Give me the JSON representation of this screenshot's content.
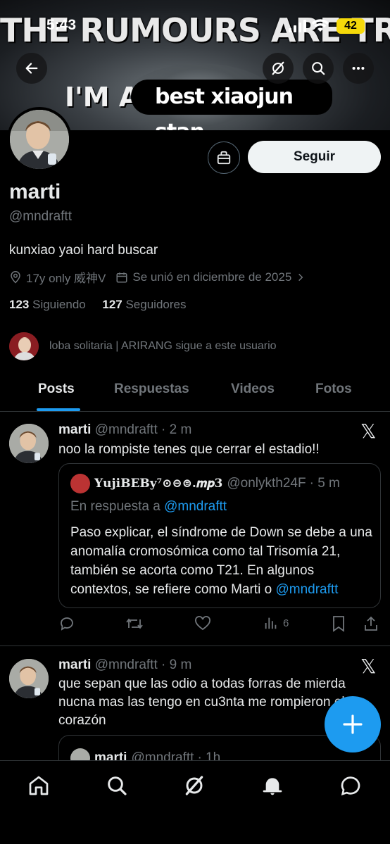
{
  "status": {
    "time": "5:43",
    "battery": "42"
  },
  "banner": {
    "line1": "THE RUMOURS ARE TRUE",
    "line2": "I'M A",
    "highlight": "best xiaojun stan"
  },
  "profile": {
    "name": "marti",
    "handle": "@mndraftt",
    "bio": "kunxiao yaoi hard buscar",
    "location": "17y only 威神V",
    "joined": "Se unió en diciembre de 2025",
    "following_count": "123",
    "following_label": "Siguiendo",
    "followers_count": "127",
    "followers_label": "Seguidores",
    "followed_by": "loba solitaria | ARIRANG sigue a este usuario",
    "follow_button": "Seguir"
  },
  "tabs": [
    "Posts",
    "Respuestas",
    "Videos",
    "Fotos"
  ],
  "posts": [
    {
      "name": "marti",
      "handle": "@mndraftt",
      "time": "· 2 m",
      "text": "noo la rompiste tenes que cerrar el estadio!!",
      "quote": {
        "name": "𝐘𝐮𝐣𝐢𝐁𝐄𝐁𝐲⁷⊙⊝⊜.𝒎𝒑𝟑",
        "handle": "@onlykth24F",
        "time": "· 5 m",
        "reply_prefix": "En respuesta a",
        "reply_handle": "@mndraftt",
        "text": "Paso explicar, el síndrome de Down se debe a una anomalía cromosómica como tal Trisomía 21, también se acorta como T21. En algunos contextos, se refiere como Marti o",
        "mention": "@mndraftt"
      },
      "views": "6"
    },
    {
      "name": "marti",
      "handle": "@mndraftt",
      "time": "· 9 m",
      "text": "que sepan que las odio a todas forras de mierda nucna mas las tengo en cu3nta me rompieron el corazón",
      "quote_preview": {
        "name": "marti",
        "handle": "@mndraftt",
        "time": "· 1h"
      }
    }
  ]
}
